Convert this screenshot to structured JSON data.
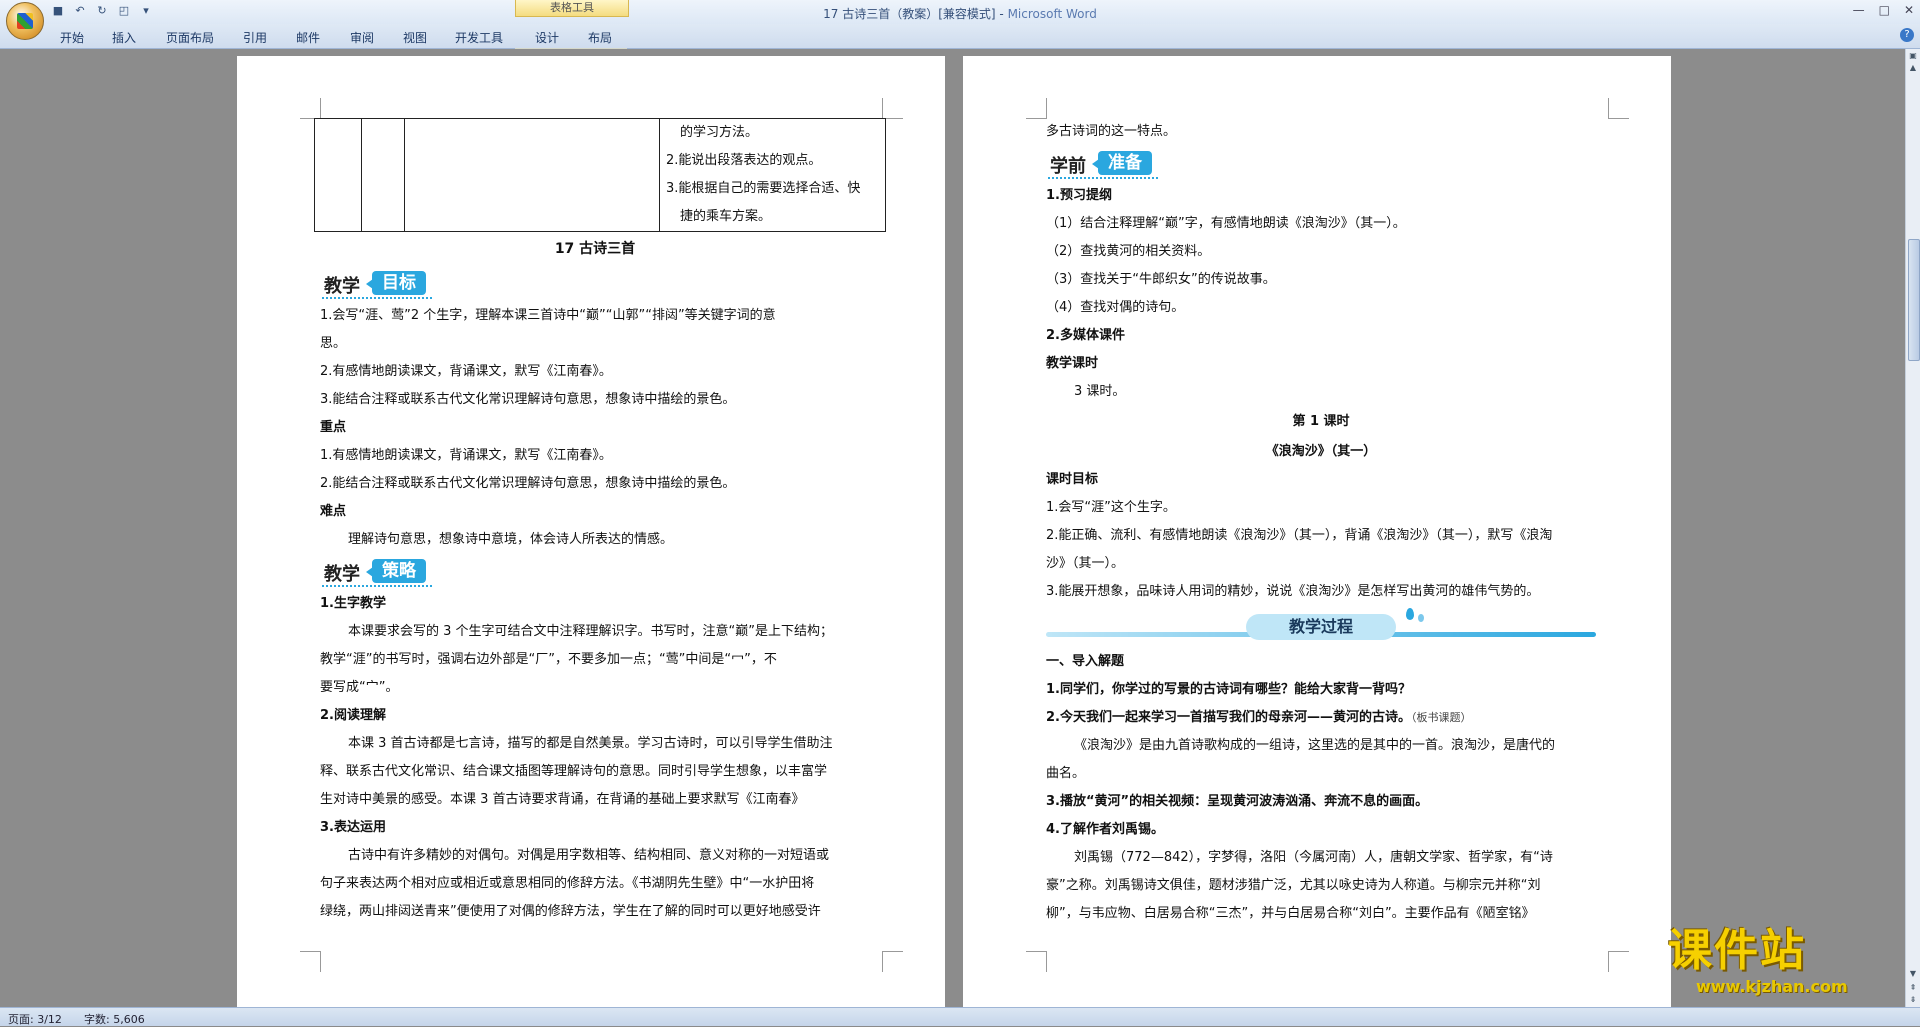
{
  "window": {
    "title": "17 古诗三首（教案）[兼容模式] - ",
    "app": "Microsoft Word",
    "context_tab_group": "表格工具"
  },
  "ribbon": {
    "tabs": [
      "开始",
      "插入",
      "页面布局",
      "引用",
      "邮件",
      "审阅",
      "视图",
      "开发工具",
      "设计",
      "布局"
    ]
  },
  "page_left": {
    "table_rows": [
      "的学习方法。",
      "2.能说出段落表达的观点。",
      "3.能根据自己的需要选择合适、快",
      "捷的乘车方案。"
    ],
    "lesson_title": "17  古诗三首",
    "goal_badge": {
      "dark": "教学",
      "blue": "目标"
    },
    "goals": [
      "1.会写“涯、莺”2 个生字，理解本课三首诗中“巅”“山郭”“排闼”等关键字词的意",
      "思。",
      "2.有感情地朗读课文，背诵课文，默写《江南春》。",
      "3.能结合注释或联系古代文化常识理解诗句意思，想象诗中描绘的景色。"
    ],
    "key_heading": "重点",
    "key_points": [
      "1.有感情地朗读课文，背诵课文，默写《江南春》。",
      "2.能结合注释或联系古代文化常识理解诗句意思，想象诗中描绘的景色。"
    ],
    "difficult_heading": "难点",
    "difficult_text": "理解诗句意思，想象诗中意境，体会诗人所表达的情感。",
    "strategy_badge": {
      "dark": "教学",
      "blue": "策略"
    },
    "s1_heading": "1.生字教学",
    "s1_lines": [
      "本课要求会写的 3 个生字可结合文中注释理解识字。书写时，注意“巅”是上下结构；",
      "教学“涯”的书写时，强调右边外部是“厂”，不要多加一点；“莺”中间是“冖”，不",
      "要写成“宀”。"
    ],
    "s2_heading": "2.阅读理解",
    "s2_lines": [
      "本课 3 首古诗都是七言诗，描写的都是自然美景。学习古诗时，可以引导学生借助注",
      "释、联系古代文化常识、结合课文插图等理解诗句的意思。同时引导学生想象，以丰富学",
      "生对诗中美景的感受。本课 3 首古诗要求背诵，在背诵的基础上要求默写《江南春》"
    ],
    "s3_heading": "3.表达运用",
    "s3_lines": [
      "古诗中有许多精妙的对偶句。对偶是用字数相等、结构相同、意义对称的一对短语或",
      "句子来表达两个相对应或相近或意思相同的修辞方法。《书湖阴先生壁》中“一水护田将",
      "绿绕，两山排闼送青来”便使用了对偶的修辞方法，学生在了解的同时可以更好地感受许"
    ]
  },
  "page_right": {
    "top_line": "多古诗词的这一特点。",
    "prep_badge": {
      "dark": "学前",
      "blue": "准备"
    },
    "p1_heading": "1.预习提纲",
    "p1_items": [
      "（1）结合注释理解“巅”字，有感情地朗读《浪淘沙》（其一）。",
      "（2）查找黄河的相关资料。",
      "（3）查找关于“牛郎织女”的传说故事。",
      "（4）查找对偶的诗句。"
    ],
    "p2_heading": "2.多媒体课件",
    "hours_heading": "教学课时",
    "hours_text": "3 课时。",
    "lesson1_title": "第 1 课时",
    "poem_title": "《浪淘沙》（其一）",
    "obj_heading": "课时目标",
    "obj_lines": [
      "1.会写“涯”这个生字。",
      "2.能正确、流利、有感情地朗读《浪淘沙》（其一），背诵《浪淘沙》（其一），默写《浪淘",
      "沙》（其一）。",
      "3.能展开想象，品味诗人用词的精妙，说说《浪淘沙》是怎样写出黄河的雄伟气势的。"
    ],
    "process_banner": "教学过程",
    "sec1": "一、导入解题",
    "q1": "1.同学们，你学过的写景的古诗词有哪些？能给大家背一背吗？",
    "q2": "2.今天我们一起来学习一首描写我们的母亲河——黄河的古诗。",
    "q2_note": "（板书课题）",
    "q2_lines": [
      "《浪淘沙》是由九首诗歌构成的一组诗，这里选的是其中的一首。浪淘沙，是唐代的",
      "曲名。"
    ],
    "q3": "3.播放“黄河”的相关视频：呈现黄河波涛汹涌、奔流不息的画面。",
    "q4": "4.了解作者刘禹锡。",
    "q4_lines": [
      "刘禹锡（772—842），字梦得，洛阳（今属河南）人，唐朝文学家、哲学家，有“诗",
      "豪”之称。刘禹锡诗文俱佳，题材涉猎广泛，尤其以咏史诗为人称道。与柳宗元并称“刘",
      "柳”，与韦应物、白居易合称“三杰”，并与白居易合称“刘白”。主要作品有《陋室铭》"
    ]
  },
  "status": {
    "page": "页面: 3/12",
    "words": "字数: 5,606"
  },
  "watermark": {
    "text": "课件站",
    "url": "www.kjzhan.com"
  }
}
